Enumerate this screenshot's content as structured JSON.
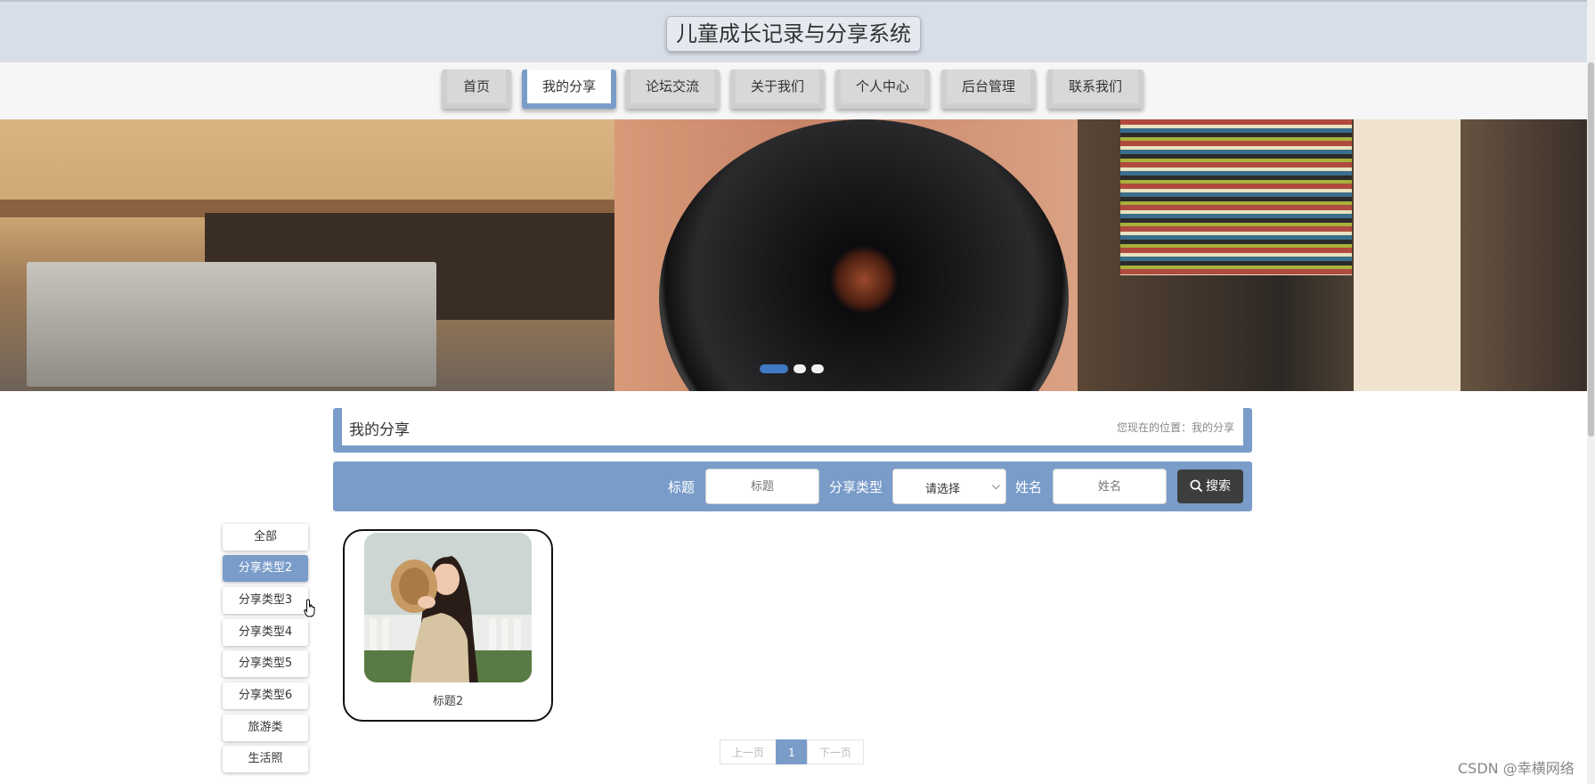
{
  "header": {
    "title": "儿童成长记录与分享系统"
  },
  "nav": {
    "items": [
      {
        "label": "首页",
        "active": false
      },
      {
        "label": "我的分享",
        "active": true
      },
      {
        "label": "论坛交流",
        "active": false
      },
      {
        "label": "关于我们",
        "active": false
      },
      {
        "label": "个人中心",
        "active": false
      },
      {
        "label": "后台管理",
        "active": false
      },
      {
        "label": "联系我们",
        "active": false
      }
    ]
  },
  "banner": {
    "slide_count": 3,
    "active_slide": 1
  },
  "breadcrumb": {
    "page_title": "我的分享",
    "location_text": "您现在的位置：我的分享"
  },
  "search": {
    "title_label": "标题",
    "title_placeholder": "标题",
    "type_label": "分享类型",
    "type_selected": "请选择",
    "name_label": "姓名",
    "name_placeholder": "姓名",
    "button_label": "搜索"
  },
  "categories": [
    {
      "label": "全部",
      "active": false
    },
    {
      "label": "分享类型2",
      "active": true
    },
    {
      "label": "分享类型3",
      "active": false
    },
    {
      "label": "分享类型4",
      "active": false
    },
    {
      "label": "分享类型5",
      "active": false
    },
    {
      "label": "分享类型6",
      "active": false
    },
    {
      "label": "旅游类",
      "active": false
    },
    {
      "label": "生活照",
      "active": false
    }
  ],
  "cards": [
    {
      "title": "标题2"
    }
  ],
  "pagination": {
    "prev": "上一页",
    "current": "1",
    "next": "下一页"
  },
  "watermark": "CSDN @幸横网络",
  "colors": {
    "accent": "#7a9cc9",
    "header_bg": "#d8dee8",
    "button_dark": "#3d3d3d"
  }
}
